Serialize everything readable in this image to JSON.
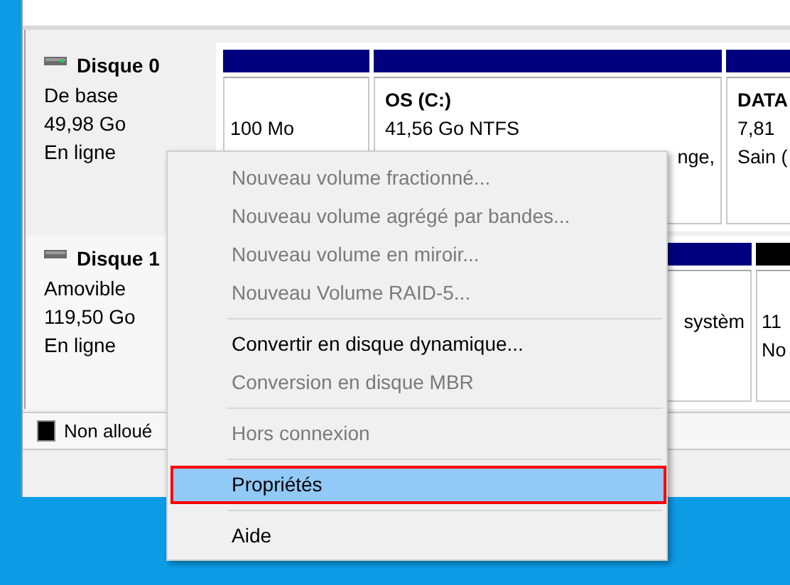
{
  "disks": [
    {
      "name": "Disque 0",
      "details": [
        "De base",
        "49,98 Go",
        "En ligne"
      ],
      "partitions": [
        {
          "kind": "primary",
          "lines": [
            {
              "text": "100 Mo",
              "kind": "plain"
            }
          ]
        },
        {
          "kind": "primary",
          "name": "OS  (C:)",
          "lines": [
            {
              "text": "41,56 Go NTFS",
              "kind": "plain"
            },
            {
              "text": "nge,",
              "kind": "fragment"
            }
          ]
        },
        {
          "kind": "primary",
          "name": "DATA",
          "lines": [
            {
              "text": "7,81",
              "kind": "plain"
            },
            {
              "text": "Sain (",
              "kind": "plain"
            }
          ]
        }
      ]
    },
    {
      "name": "Disque 1",
      "details": [
        "Amovible",
        "119,50 Go",
        "En ligne"
      ],
      "partitions": [
        {
          "kind": "primary",
          "lines": [
            {
              "text": "systèm",
              "kind": "fragment"
            }
          ]
        },
        {
          "kind": "unallocated",
          "lines": [
            {
              "text": "11",
              "kind": "plain"
            },
            {
              "text": "No",
              "kind": "plain"
            }
          ]
        }
      ]
    }
  ],
  "legend": [
    {
      "label": "Non alloué",
      "kind": "unallocated"
    }
  ],
  "menu": [
    {
      "kind": "item",
      "label": "Nouveau volume fractionné...",
      "disabled": true,
      "selected": false,
      "outlined": false
    },
    {
      "kind": "item",
      "label": "Nouveau volume agrégé par bandes...",
      "disabled": true,
      "selected": false,
      "outlined": false
    },
    {
      "kind": "item",
      "label": "Nouveau volume en miroir...",
      "disabled": true,
      "selected": false,
      "outlined": false
    },
    {
      "kind": "item",
      "label": "Nouveau Volume RAID-5...",
      "disabled": true,
      "selected": false,
      "outlined": false
    },
    {
      "kind": "separator"
    },
    {
      "kind": "item",
      "label": "Convertir en disque dynamique...",
      "disabled": false,
      "selected": false,
      "outlined": false
    },
    {
      "kind": "item",
      "label": "Conversion en disque MBR",
      "disabled": true,
      "selected": false,
      "outlined": false
    },
    {
      "kind": "separator"
    },
    {
      "kind": "item",
      "label": "Hors connexion",
      "disabled": true,
      "selected": false,
      "outlined": false
    },
    {
      "kind": "separator"
    },
    {
      "kind": "item",
      "label": "Propriétés",
      "disabled": false,
      "selected": true,
      "outlined": true
    },
    {
      "kind": "separator"
    },
    {
      "kind": "item",
      "label": "Aide",
      "disabled": false,
      "selected": false,
      "outlined": false
    }
  ]
}
